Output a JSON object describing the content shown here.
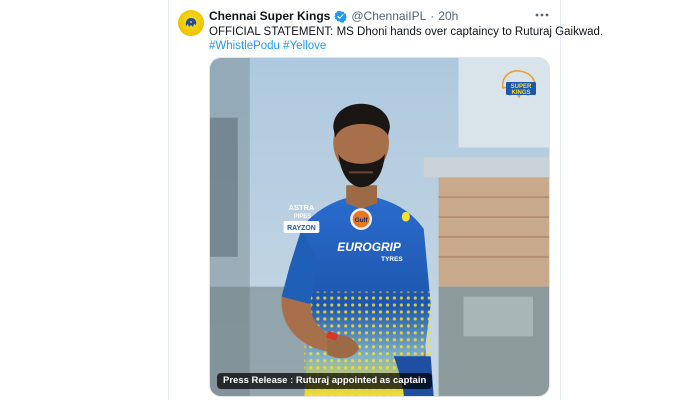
{
  "tweet": {
    "display_name": "Chennai Super Kings",
    "handle": "@ChennaiIPL",
    "separator": "·",
    "time": "20h",
    "text_line1": "OFFICIAL STATEMENT: MS Dhoni hands over captaincy to Ruturaj Gaikwad.",
    "hashtag1": "#WhistlePodu",
    "hashtag2": "#Yellove",
    "verified_color": "#1d9bf0",
    "avatar_color": "#f2c600"
  },
  "media": {
    "caption": "Press Release : Ruturaj appointed as captain",
    "logo_text_line1": "SUPER",
    "logo_text_line2": "KINGS",
    "jersey_sponsor_chest": "Gulf",
    "jersey_sponsor_main": "EUROGRIP",
    "jersey_sponsor_sub": "TYRES",
    "sleeve_sponsor_top": "ASTRA",
    "sleeve_sponsor_top2": "PIPES",
    "sleeve_sponsor_bottom": "RAYZON",
    "jersey_color": "#1f5fb8",
    "jersey_accent": "#f5e12e"
  },
  "icons": {
    "more": "more-horizontal-icon",
    "verified": "verified-badge-icon",
    "logo": "csk-lion-logo-icon"
  }
}
